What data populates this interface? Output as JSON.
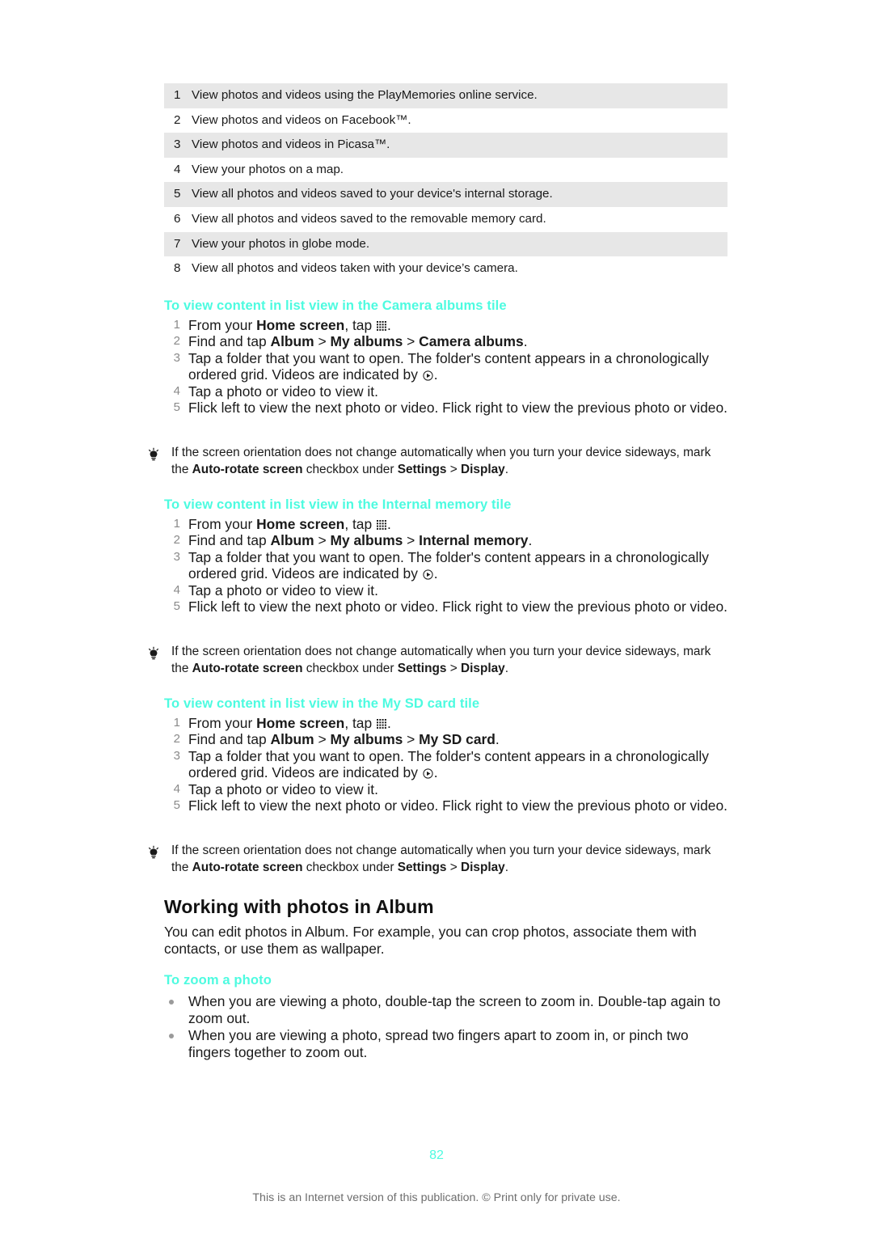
{
  "legend": {
    "rows": [
      {
        "num": "1",
        "text": "View photos and videos using the PlayMemories online service."
      },
      {
        "num": "2",
        "text": "View photos and videos on Facebook™."
      },
      {
        "num": "3",
        "text": "View photos and videos in Picasa™."
      },
      {
        "num": "4",
        "text": "View your photos on a map."
      },
      {
        "num": "5",
        "text": "View all photos and videos saved to your device's internal storage."
      },
      {
        "num": "6",
        "text": "View all photos and videos saved to the removable memory card."
      },
      {
        "num": "7",
        "text": "View your photos in globe mode."
      },
      {
        "num": "8",
        "text": "View all photos and videos taken with your device’s camera."
      }
    ]
  },
  "sections": [
    {
      "heading": "To view content in list view in the Camera albums tile",
      "steps": [
        {
          "num": "1",
          "pre": "From your ",
          "bold1": "Home screen",
          "mid": ", tap ",
          "icon": "app-grid-icon",
          "post": "."
        },
        {
          "num": "2",
          "pre": "Find and tap ",
          "bold1": "Album",
          "sep1": " > ",
          "bold2": "My albums",
          "sep2": " > ",
          "bold3": "Camera albums",
          "post": "."
        },
        {
          "num": "3",
          "pre": "Tap a folder that you want to open. The folder's content appears in a chronologically ordered grid. Videos are indicated by ",
          "icon": "play-icon",
          "post": "."
        },
        {
          "num": "4",
          "pre": "Tap a photo or video to view it."
        },
        {
          "num": "5",
          "pre": "Flick left to view the next photo or video. Flick right to view the previous photo or video."
        }
      ],
      "tip": {
        "icon": "lightbulb-icon",
        "pre": "If the screen orientation does not change automatically when you turn your device sideways, mark the ",
        "bold1": "Auto-rotate screen",
        "mid": " checkbox under ",
        "bold2": "Settings",
        "sep": " > ",
        "bold3": "Display",
        "post": "."
      }
    },
    {
      "heading": "To view content in list view in the Internal memory tile",
      "steps": [
        {
          "num": "1",
          "pre": "From your ",
          "bold1": "Home screen",
          "mid": ", tap ",
          "icon": "app-grid-icon",
          "post": "."
        },
        {
          "num": "2",
          "pre": "Find and tap ",
          "bold1": "Album",
          "sep1": " > ",
          "bold2": "My albums",
          "sep2": " > ",
          "bold3": "Internal memory",
          "post": "."
        },
        {
          "num": "3",
          "pre": "Tap a folder that you want to open. The folder's content appears in a chronologically ordered grid. Videos are indicated by ",
          "icon": "play-icon",
          "post": "."
        },
        {
          "num": "4",
          "pre": "Tap a photo or video to view it."
        },
        {
          "num": "5",
          "pre": "Flick left to view the next photo or video. Flick right to view the previous photo or video."
        }
      ],
      "tip": {
        "icon": "lightbulb-icon",
        "pre": "If the screen orientation does not change automatically when you turn your device sideways, mark the ",
        "bold1": "Auto-rotate screen",
        "mid": " checkbox under ",
        "bold2": "Settings",
        "sep": " > ",
        "bold3": "Display",
        "post": "."
      }
    },
    {
      "heading": "To view content in list view in the My SD card tile",
      "steps": [
        {
          "num": "1",
          "pre": "From your ",
          "bold1": "Home screen",
          "mid": ", tap ",
          "icon": "app-grid-icon",
          "post": "."
        },
        {
          "num": "2",
          "pre": "Find and tap ",
          "bold1": "Album",
          "sep1": " > ",
          "bold2": "My albums",
          "sep2": " > ",
          "bold3": "My SD card",
          "post": "."
        },
        {
          "num": "3",
          "pre": "Tap a folder that you want to open. The folder's content appears in a chronologically ordered grid. Videos are indicated by ",
          "icon": "play-icon",
          "post": "."
        },
        {
          "num": "4",
          "pre": "Tap a photo or video to view it."
        },
        {
          "num": "5",
          "pre": "Flick left to view the next photo or video. Flick right to view the previous photo or video."
        }
      ],
      "tip": {
        "icon": "lightbulb-icon",
        "pre": "If the screen orientation does not change automatically when you turn your device sideways, mark the ",
        "bold1": "Auto-rotate screen",
        "mid": " checkbox under ",
        "bold2": "Settings",
        "sep": " > ",
        "bold3": "Display",
        "post": "."
      }
    }
  ],
  "album_section": {
    "title": "Working with photos in Album",
    "intro": "You can edit photos in Album. For example, you can crop photos, associate them with contacts, or use them as wallpaper.",
    "subheading": "To zoom a photo",
    "bullets": [
      "When you are viewing a photo, double-tap the screen to zoom in. Double-tap again to zoom out.",
      "When you are viewing a photo, spread two fingers apart to zoom in, or pinch two fingers together to zoom out."
    ]
  },
  "footer": {
    "page_number": "82",
    "note": "This is an Internet version of this publication. © Print only for private use."
  },
  "colors": {
    "accent": "#4dfbe0",
    "row_alt": "#e7e7e7",
    "body_text": "#1a1a1a",
    "muted": "#6d6d6d"
  }
}
